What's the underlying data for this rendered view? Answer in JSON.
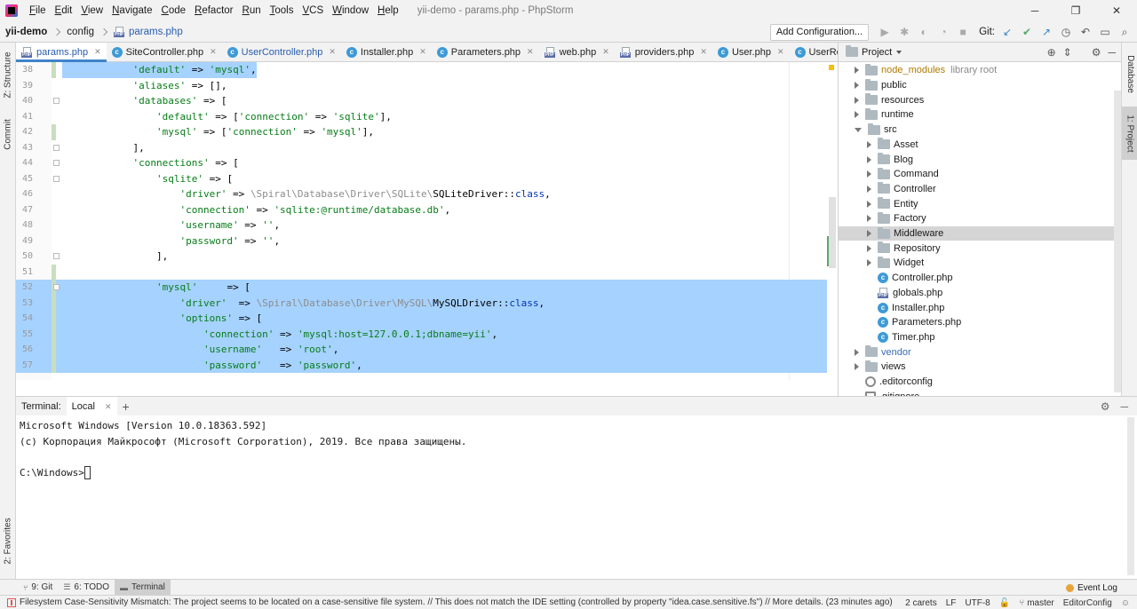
{
  "window": {
    "title": "yii-demo - params.php - PhpStorm",
    "menu": [
      "File",
      "Edit",
      "View",
      "Navigate",
      "Code",
      "Refactor",
      "Run",
      "Tools",
      "VCS",
      "Window",
      "Help"
    ],
    "controls": {
      "minimize": "─",
      "restore": "❐",
      "close": "✕"
    }
  },
  "navbar": {
    "breadcrumbs": [
      "yii-demo",
      "config",
      "params.php"
    ],
    "add_configuration": "Add Configuration...",
    "git_label": "Git:"
  },
  "left_strip": {
    "structure": "Z: Structure",
    "commit": "Commit",
    "favorites": "2: Favorites"
  },
  "right_strip": {
    "database": "Database",
    "project": "1: Project"
  },
  "tabs": [
    {
      "label": "params.php",
      "icon": "php-file-icon",
      "active": true
    },
    {
      "label": "SiteController.php",
      "icon": "class-icon"
    },
    {
      "label": "UserController.php",
      "icon": "class-icon",
      "modified": true
    },
    {
      "label": "Installer.php",
      "icon": "class-icon"
    },
    {
      "label": "Parameters.php",
      "icon": "class-icon"
    },
    {
      "label": "web.php",
      "icon": "php-file-icon"
    },
    {
      "label": "providers.php",
      "icon": "php-file-icon"
    },
    {
      "label": "User.php",
      "icon": "class-icon"
    },
    {
      "label": "UserRepository",
      "icon": "class-icon"
    }
  ],
  "editor": {
    "lines": [
      {
        "n": "38",
        "text": "            'default' => 'mysql',",
        "sel": false
      },
      {
        "n": "39",
        "text": "            'aliases' => [],",
        "sel": false
      },
      {
        "n": "40",
        "text": "            'databases' => [",
        "sel": false
      },
      {
        "n": "41",
        "text": "                'default' => ['connection' => 'sqlite'],",
        "sel": false
      },
      {
        "n": "42",
        "text": "                'mysql' => ['connection' => 'mysql'],",
        "sel": false
      },
      {
        "n": "43",
        "text": "            ],",
        "sel": false
      },
      {
        "n": "44",
        "text": "            'connections' => [",
        "sel": false
      },
      {
        "n": "45",
        "text": "                'sqlite' => [",
        "sel": false
      },
      {
        "n": "46",
        "text": "                    'driver' => \\Spiral\\Database\\Driver\\SQLite\\SQLiteDriver::class,",
        "sel": false
      },
      {
        "n": "47",
        "text": "                    'connection' => 'sqlite:@runtime/database.db',",
        "sel": false
      },
      {
        "n": "48",
        "text": "                    'username' => '',",
        "sel": false
      },
      {
        "n": "49",
        "text": "                    'password' => '',",
        "sel": false
      },
      {
        "n": "50",
        "text": "                ],",
        "sel": false
      },
      {
        "n": "51",
        "text": "",
        "sel": false
      },
      {
        "n": "52",
        "text": "                'mysql'     => [",
        "sel": true
      },
      {
        "n": "53",
        "text": "                    'driver'  => \\Spiral\\Database\\Driver\\MySQL\\MySQLDriver::class,",
        "sel": true
      },
      {
        "n": "54",
        "text": "                    'options' => [",
        "sel": true
      },
      {
        "n": "55",
        "text": "                        'connection' => 'mysql:host=127.0.0.1;dbname=yii',",
        "sel": true
      },
      {
        "n": "56",
        "text": "                        'username'   => 'root',",
        "sel": true
      },
      {
        "n": "57",
        "text": "                        'password'   => 'password',",
        "sel": true
      }
    ]
  },
  "project": {
    "title": "Project",
    "tree": [
      {
        "label": "node_modules",
        "note": "library root",
        "type": "folder",
        "depth": 0,
        "expanded": false,
        "muted": true
      },
      {
        "label": "public",
        "type": "folder",
        "depth": 0,
        "expanded": false
      },
      {
        "label": "resources",
        "type": "folder",
        "depth": 0,
        "expanded": false
      },
      {
        "label": "runtime",
        "type": "folder",
        "depth": 0,
        "expanded": false
      },
      {
        "label": "src",
        "type": "folder",
        "depth": 0,
        "expanded": true
      },
      {
        "label": "Asset",
        "type": "folder",
        "depth": 1,
        "expanded": false
      },
      {
        "label": "Blog",
        "type": "folder",
        "depth": 1,
        "expanded": false
      },
      {
        "label": "Command",
        "type": "folder",
        "depth": 1,
        "expanded": false
      },
      {
        "label": "Controller",
        "type": "folder",
        "depth": 1,
        "expanded": false
      },
      {
        "label": "Entity",
        "type": "folder",
        "depth": 1,
        "expanded": false
      },
      {
        "label": "Factory",
        "type": "folder",
        "depth": 1,
        "expanded": false
      },
      {
        "label": "Middleware",
        "type": "folder",
        "depth": 1,
        "expanded": false,
        "selected": true
      },
      {
        "label": "Repository",
        "type": "folder",
        "depth": 1,
        "expanded": false
      },
      {
        "label": "Widget",
        "type": "folder",
        "depth": 1,
        "expanded": false
      },
      {
        "label": "Controller.php",
        "type": "class",
        "depth": 1
      },
      {
        "label": "globals.php",
        "type": "php",
        "depth": 1
      },
      {
        "label": "Installer.php",
        "type": "class",
        "depth": 1
      },
      {
        "label": "Parameters.php",
        "type": "class",
        "depth": 1
      },
      {
        "label": "Timer.php",
        "type": "class",
        "depth": 1
      },
      {
        "label": "vendor",
        "type": "folder",
        "depth": 0,
        "expanded": false,
        "vendor": true
      },
      {
        "label": "views",
        "type": "folder",
        "depth": 0,
        "expanded": false
      },
      {
        "label": ".editorconfig",
        "type": "config",
        "depth": 0
      },
      {
        "label": ".gitignore",
        "type": "file",
        "depth": 0
      }
    ]
  },
  "terminal": {
    "label": "Terminal:",
    "tab": "Local",
    "lines": [
      "Microsoft Windows [Version 10.0.18363.592]",
      "(c) Корпорация Майкрософт (Microsoft Corporation), 2019. Все права защищены.",
      "",
      "C:\\Windows>"
    ]
  },
  "bottom_tools": [
    {
      "label": "9: Git",
      "icon": "git-icon"
    },
    {
      "label": "6: TODO",
      "icon": "todo-icon"
    },
    {
      "label": "Terminal",
      "icon": "terminal-icon",
      "active": true
    }
  ],
  "event_log": "Event Log",
  "status": {
    "message": "Filesystem Case-Sensitivity Mismatch: The project seems to be located on a case-sensitive file system. // This does not match the IDE setting (controlled by property \"idea.case.sensitive.fs\") // More details. (23 minutes ago)",
    "carets": "2 carets",
    "line_sep": "LF",
    "encoding": "UTF-8",
    "branch": "master",
    "editorconfig": "EditorConfig"
  },
  "colors": {
    "selection": "#a6d2ff",
    "string": "#067d17",
    "keyword": "#0033b3",
    "accent": "#4083c9"
  }
}
